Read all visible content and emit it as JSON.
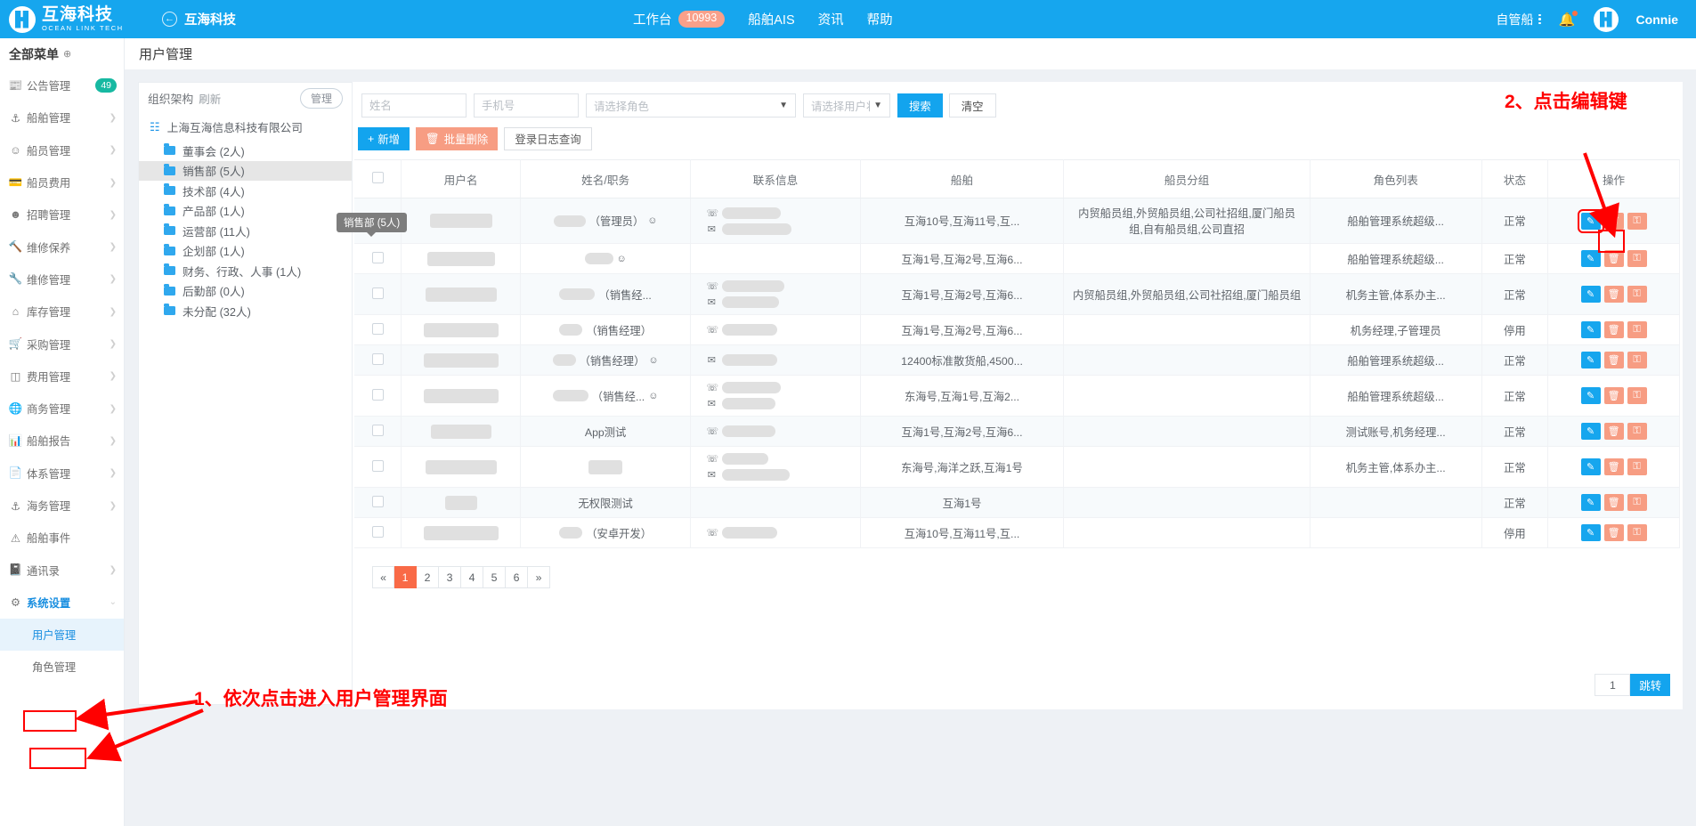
{
  "topbar": {
    "brand_cn": "互海科技",
    "brand_en": "OCEAN LINK TECH",
    "back_label": "互海科技",
    "back_icon": "arrow-left-circle-icon",
    "nav": [
      {
        "label": "工作台",
        "badge": "10993"
      },
      {
        "label": "船舶AIS",
        "badge": ""
      },
      {
        "label": "资讯",
        "badge": ""
      },
      {
        "label": "帮助",
        "badge": ""
      }
    ],
    "vessel_selector": "自管船",
    "bell_icon": "bell-icon",
    "username": "Connie"
  },
  "sidebar": {
    "all_menu": "全部菜单",
    "items": [
      {
        "label": "公告管理",
        "icon": "announcement-icon",
        "badge": "49",
        "arrow": false
      },
      {
        "label": "船舶管理",
        "icon": "anchor-icon",
        "badge": "",
        "arrow": true
      },
      {
        "label": "船员管理",
        "icon": "user-icon",
        "badge": "",
        "arrow": true
      },
      {
        "label": "船员费用",
        "icon": "card-icon",
        "badge": "",
        "arrow": true
      },
      {
        "label": "招聘管理",
        "icon": "recruit-icon",
        "badge": "",
        "arrow": true
      },
      {
        "label": "维修保养",
        "icon": "hammer-icon",
        "badge": "",
        "arrow": true
      },
      {
        "label": "维修管理",
        "icon": "wrench-icon",
        "badge": "",
        "arrow": true
      },
      {
        "label": "库存管理",
        "icon": "warehouse-icon",
        "badge": "",
        "arrow": true
      },
      {
        "label": "采购管理",
        "icon": "cart-icon",
        "badge": "",
        "arrow": true
      },
      {
        "label": "费用管理",
        "icon": "database-icon",
        "badge": "",
        "arrow": true
      },
      {
        "label": "商务管理",
        "icon": "globe-icon",
        "badge": "",
        "arrow": true
      },
      {
        "label": "船舶报告",
        "icon": "report-icon",
        "badge": "",
        "arrow": true
      },
      {
        "label": "体系管理",
        "icon": "docs-icon",
        "badge": "",
        "arrow": true
      },
      {
        "label": "海务管理",
        "icon": "buoy-icon",
        "badge": "",
        "arrow": true
      },
      {
        "label": "船舶事件",
        "icon": "warning-icon",
        "badge": "",
        "arrow": false
      },
      {
        "label": "通讯录",
        "icon": "contacts-icon",
        "badge": "",
        "arrow": true
      }
    ],
    "system": {
      "label": "系统设置",
      "icon": "gear-icon",
      "arrow": "chevron-down-icon"
    },
    "sub_items": [
      {
        "label": "用户管理",
        "selected": true
      },
      {
        "label": "角色管理",
        "selected": false
      }
    ]
  },
  "page": {
    "title": "用户管理"
  },
  "org": {
    "title": "组织架构",
    "refresh": "刷新",
    "manage": "管理",
    "root": "上海互海信息科技有限公司",
    "root_icon": "sitemap-icon",
    "tooltip": "销售部 (5人)",
    "nodes": [
      {
        "label": "董事会 (2人)",
        "selected": false
      },
      {
        "label": "销售部 (5人)",
        "selected": true
      },
      {
        "label": "技术部 (4人)",
        "selected": false
      },
      {
        "label": "产品部 (1人)",
        "selected": false
      },
      {
        "label": "运营部 (11人)",
        "selected": false
      },
      {
        "label": "企划部 (1人)",
        "selected": false
      },
      {
        "label": "财务、行政、人事 (1人)",
        "selected": false
      },
      {
        "label": "后勤部 (0人)",
        "selected": false
      },
      {
        "label": "未分配 (32人)",
        "selected": false
      }
    ]
  },
  "filters": {
    "name_placeholder": "姓名",
    "name_value": "",
    "phone_placeholder": "手机号",
    "phone_value": "",
    "role_placeholder": "请选择角色",
    "status_placeholder": "请选择用户状态",
    "search_label": "搜索",
    "clear_label": "清空"
  },
  "actions": {
    "add_label": "新增",
    "add_icon": "plus-icon",
    "batch_delete_label": "批量删除",
    "batch_delete_icon": "trash-icon",
    "login_log_label": "登录日志查询"
  },
  "table": {
    "columns": [
      "",
      "用户名",
      "姓名/职务",
      "联系信息",
      "船舶",
      "船员分组",
      "角色列表",
      "状态",
      "操作"
    ],
    "rows": [
      {
        "username": "",
        "name": "",
        "duty": "（管理员）",
        "phone": "",
        "email": "",
        "ship": "互海10号,互海11号,互...",
        "group": "内贸船员组,外贸船员组,公司社招组,厦门船员组,自有船员组,公司直招",
        "roles": "船舶管理系统超级...",
        "status": "正常",
        "edit_highlight": true,
        "alt": true
      },
      {
        "username": "",
        "name": "",
        "duty": "",
        "phone": "",
        "email": "",
        "ship": "互海1号,互海2号,互海6...",
        "group": "",
        "roles": "船舶管理系统超级...",
        "status": "正常",
        "edit_highlight": false,
        "alt": false
      },
      {
        "username": "",
        "name": "",
        "duty": "（销售经...",
        "phone": "",
        "email": "",
        "ship": "互海1号,互海2号,互海6...",
        "group": "内贸船员组,外贸船员组,公司社招组,厦门船员组",
        "roles": "机务主管,体系办主...",
        "status": "正常",
        "edit_highlight": false,
        "alt": true
      },
      {
        "username": "",
        "name": "",
        "duty": "（销售经理）",
        "phone": "",
        "email": "",
        "ship": "互海1号,互海2号,互海6...",
        "group": "",
        "roles": "机务经理,子管理员",
        "status": "停用",
        "edit_highlight": false,
        "alt": false
      },
      {
        "username": "",
        "name": "",
        "duty": "（销售经理）",
        "phone": "",
        "email": "",
        "ship": "12400标准散货船,4500...",
        "group": "",
        "roles": "船舶管理系统超级...",
        "status": "正常",
        "edit_highlight": false,
        "alt": true
      },
      {
        "username": "",
        "name": "",
        "duty": "（销售经...",
        "phone": "",
        "email": "",
        "ship": "东海号,互海1号,互海2...",
        "group": "",
        "roles": "船舶管理系统超级...",
        "status": "正常",
        "edit_highlight": false,
        "alt": false
      },
      {
        "username": "",
        "name": "App测试",
        "duty": "",
        "phone": "",
        "email": "",
        "ship": "互海1号,互海2号,互海6...",
        "group": "",
        "roles": "测试账号,机务经理...",
        "status": "正常",
        "edit_highlight": false,
        "alt": true
      },
      {
        "username": "",
        "name": "",
        "duty": "",
        "phone": "",
        "email": "",
        "ship": "东海号,海洋之跃,互海1号",
        "group": "",
        "roles": "机务主管,体系办主...",
        "status": "正常",
        "edit_highlight": false,
        "alt": false
      },
      {
        "username": "",
        "name": "无权限测试",
        "duty": "",
        "phone": "",
        "email": "",
        "ship": "互海1号",
        "group": "",
        "roles": "",
        "status": "正常",
        "edit_highlight": false,
        "alt": true
      },
      {
        "username": "",
        "name": "",
        "duty": "（安卓开发）",
        "phone": "",
        "email": "",
        "ship": "互海10号,互海11号,互...",
        "group": "",
        "roles": "",
        "status": "停用",
        "edit_highlight": false,
        "alt": false
      }
    ],
    "op_icons": {
      "edit": "pencil-icon",
      "delete": "trash-icon",
      "key": "key-icon"
    }
  },
  "pagination": {
    "prev": "«",
    "pages": [
      "1",
      "2",
      "3",
      "4",
      "5",
      "6"
    ],
    "next": "»",
    "current": "1",
    "jump_value": "1",
    "jump_label": "跳转"
  },
  "annotations": [
    {
      "id": "anno-step-1",
      "text": "1、依次点击进入用户管理界面"
    },
    {
      "id": "anno-step-2",
      "text": "2、点击编辑键"
    }
  ]
}
